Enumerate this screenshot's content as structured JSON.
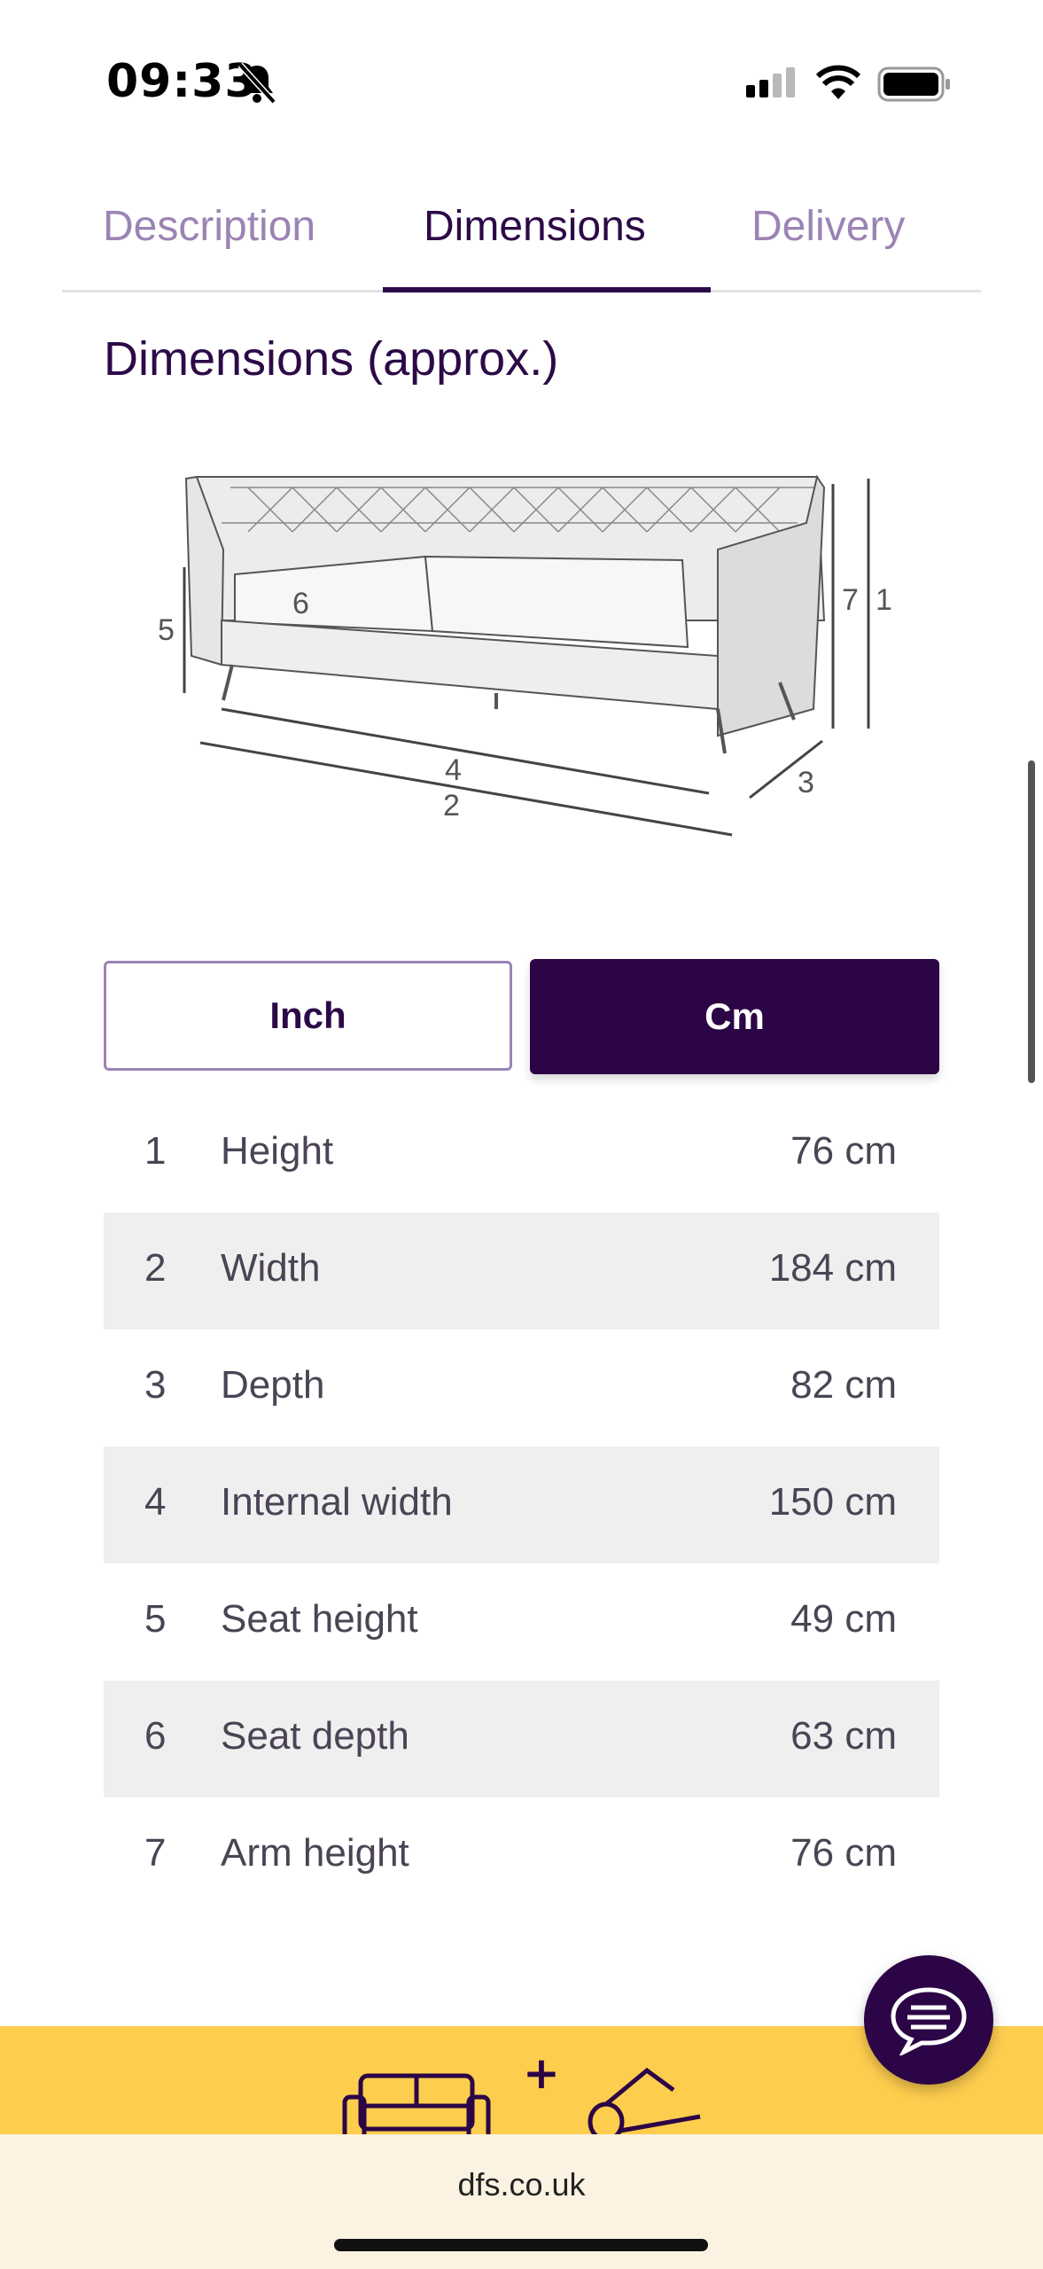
{
  "status_bar": {
    "time": "09:33"
  },
  "tabs": [
    {
      "label": "Description",
      "active": false
    },
    {
      "label": "Dimensions",
      "active": true
    },
    {
      "label": "Delivery",
      "active": false
    }
  ],
  "section_title": "Dimensions (approx.)",
  "diagram_labels": [
    "1",
    "2",
    "3",
    "4",
    "5",
    "6",
    "7"
  ],
  "units": {
    "inch_label": "Inch",
    "cm_label": "Cm",
    "selected": "Cm"
  },
  "dimensions": [
    {
      "num": "1",
      "label": "Height",
      "value": "76 cm"
    },
    {
      "num": "2",
      "label": "Width",
      "value": "184 cm"
    },
    {
      "num": "3",
      "label": "Depth",
      "value": "82 cm"
    },
    {
      "num": "4",
      "label": "Internal width",
      "value": "150 cm"
    },
    {
      "num": "5",
      "label": "Seat height",
      "value": "49 cm"
    },
    {
      "num": "6",
      "label": "Seat depth",
      "value": "63 cm"
    },
    {
      "num": "7",
      "label": "Arm height",
      "value": "76 cm"
    }
  ],
  "promo": {
    "plus": "+"
  },
  "browser": {
    "url": "dfs.co.uk"
  },
  "colors": {
    "brand_purple": "#2c0546",
    "tab_inactive": "#9b84b4",
    "promo_yellow": "#fdcd4e",
    "browser_bar": "#fbf2e1"
  }
}
